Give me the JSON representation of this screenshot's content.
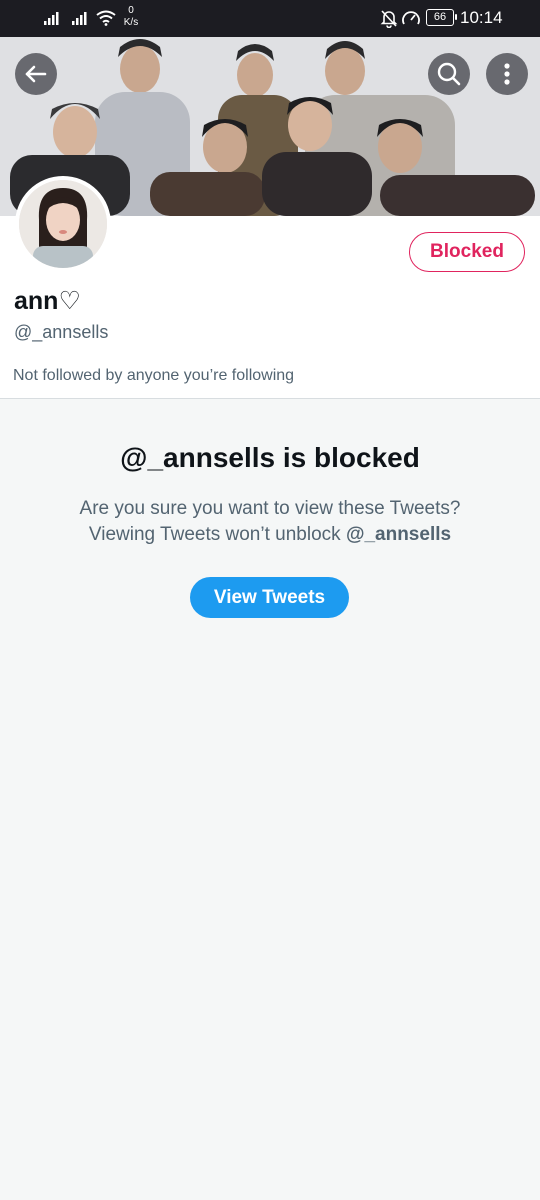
{
  "status_bar": {
    "net_speed_value": "0",
    "net_speed_unit": "K/s",
    "battery": "66",
    "time": "10:14"
  },
  "header": {
    "back_icon": "arrow-left-icon",
    "search_icon": "search-icon",
    "more_icon": "more-vertical-icon"
  },
  "profile": {
    "display_name": "ann♡",
    "handle": "@_annsells",
    "follow_note": "Not followed by anyone you’re following",
    "blocked_label": "Blocked"
  },
  "blocked_notice": {
    "title": "@_annsells is blocked",
    "line1": "Are you sure you want to view these Tweets?",
    "line2_prefix": "Viewing Tweets won’t unblock ",
    "line2_handle": "@_annsells",
    "button_label": "View Tweets"
  },
  "colors": {
    "accent_blue": "#1d9bf0",
    "blocked_red": "#e0245e",
    "secondary_text": "#536471"
  }
}
